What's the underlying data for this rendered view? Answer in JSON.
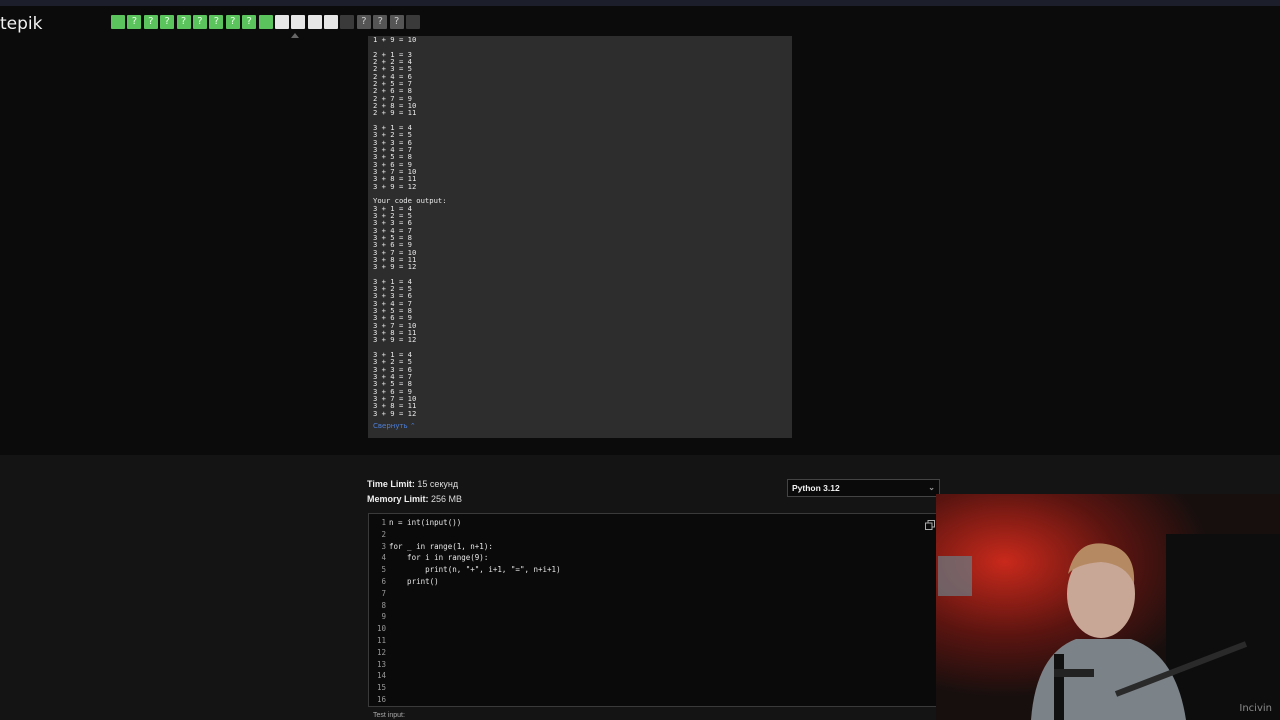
{
  "app": {
    "logo": "tepik"
  },
  "steps": [
    {
      "state": "correct",
      "glyph": ""
    },
    {
      "state": "correct",
      "glyph": "?"
    },
    {
      "state": "correct",
      "glyph": "?"
    },
    {
      "state": "correct",
      "glyph": "?"
    },
    {
      "state": "correct",
      "glyph": "?"
    },
    {
      "state": "correct",
      "glyph": "?"
    },
    {
      "state": "correct",
      "glyph": "?"
    },
    {
      "state": "correct",
      "glyph": "?"
    },
    {
      "state": "correct",
      "glyph": "?"
    },
    {
      "state": "correct",
      "glyph": ""
    },
    {
      "state": "white",
      "glyph": ""
    },
    {
      "state": "white",
      "glyph": ""
    },
    {
      "state": "white",
      "glyph": ""
    },
    {
      "state": "white",
      "glyph": ""
    },
    {
      "state": "dark",
      "glyph": ""
    },
    {
      "state": "gray",
      "glyph": "?"
    },
    {
      "state": "gray",
      "glyph": "?"
    },
    {
      "state": "gray",
      "glyph": "?"
    },
    {
      "state": "dark",
      "glyph": ""
    }
  ],
  "output": {
    "text": "1 + 9 = 10\n\n2 + 1 = 3\n2 + 2 = 4\n2 + 3 = 5\n2 + 4 = 6\n2 + 5 = 7\n2 + 6 = 8\n2 + 7 = 9\n2 + 8 = 10\n2 + 9 = 11\n\n3 + 1 = 4\n3 + 2 = 5\n3 + 3 = 6\n3 + 4 = 7\n3 + 5 = 8\n3 + 6 = 9\n3 + 7 = 10\n3 + 8 = 11\n3 + 9 = 12\n\nYour code output:\n3 + 1 = 4\n3 + 2 = 5\n3 + 3 = 6\n3 + 4 = 7\n3 + 5 = 8\n3 + 6 = 9\n3 + 7 = 10\n3 + 8 = 11\n3 + 9 = 12\n\n3 + 1 = 4\n3 + 2 = 5\n3 + 3 = 6\n3 + 4 = 7\n3 + 5 = 8\n3 + 6 = 9\n3 + 7 = 10\n3 + 8 = 11\n3 + 9 = 12\n\n3 + 1 = 4\n3 + 2 = 5\n3 + 3 = 6\n3 + 4 = 7\n3 + 5 = 8\n3 + 6 = 9\n3 + 7 = 10\n3 + 8 = 11\n3 + 9 = 12",
    "collapse_label": "Свернуть ⌃"
  },
  "limits": {
    "time_label": "Time Limit:",
    "time_value": "15 секунд",
    "memory_label": "Memory Limit:",
    "memory_value": "256 MB"
  },
  "language": {
    "selected": "Python 3.12"
  },
  "editor": {
    "line_numbers": "1\n2\n3\n4\n5\n6\n7\n8\n9\n10\n11\n12\n13\n14\n15\n16",
    "lines": [
      "n = int(input())",
      "",
      "for _ in range(1, n+1):",
      "    for i in range(9):",
      "        print(n, \"+\", i+1, \"=\", n+i+1)",
      "    print()"
    ]
  },
  "test_input_label": "Test input:",
  "watermark": "Incivin"
}
